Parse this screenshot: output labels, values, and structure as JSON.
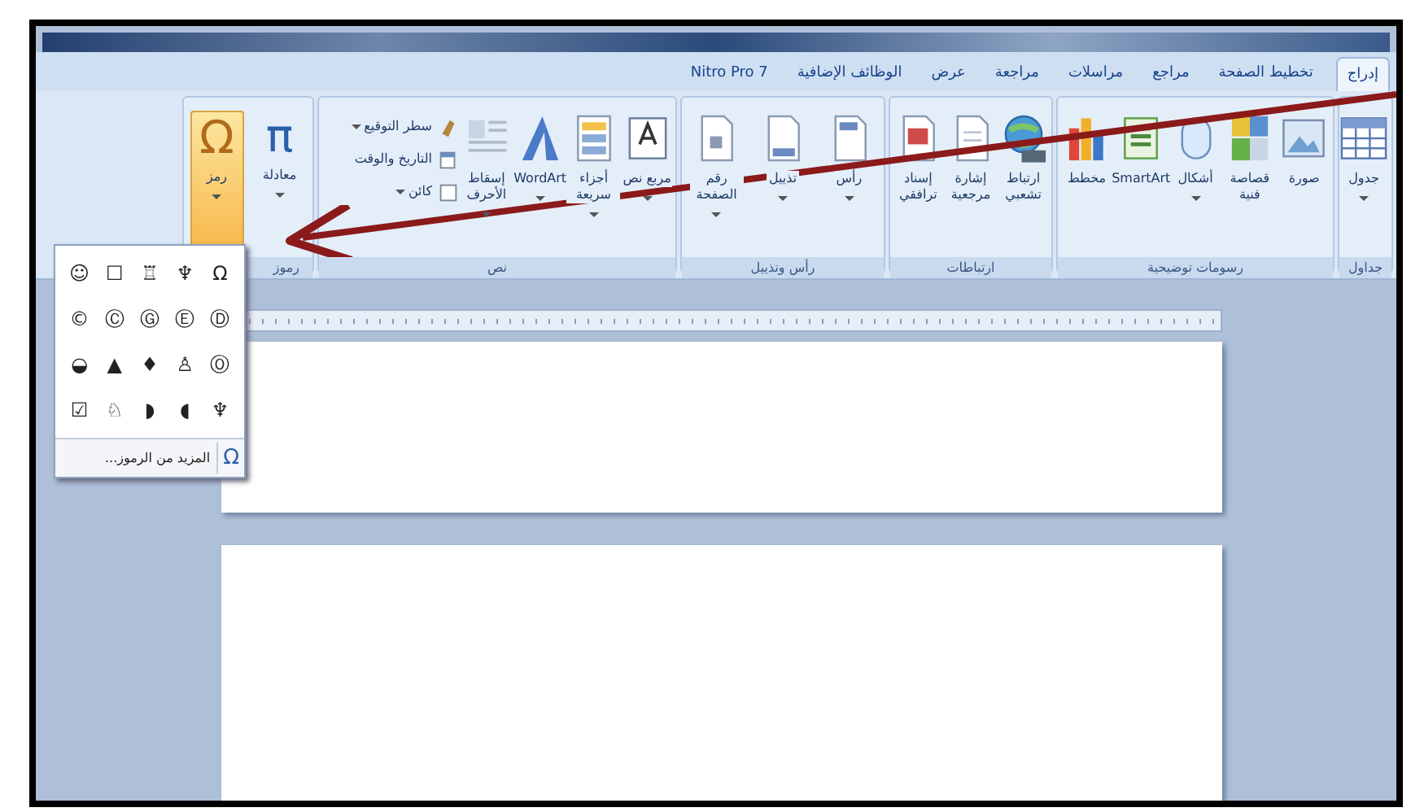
{
  "tabs": [
    {
      "label": "إدراج",
      "selected": true
    },
    {
      "label": "تخطيط الصفحة",
      "selected": false
    },
    {
      "label": "مراجع",
      "selected": false
    },
    {
      "label": "مراسلات",
      "selected": false
    },
    {
      "label": "مراجعة",
      "selected": false
    },
    {
      "label": "عرض",
      "selected": false
    },
    {
      "label": "الوظائف الإضافية",
      "selected": false
    },
    {
      "label": "Nitro Pro 7",
      "selected": false
    }
  ],
  "ribbon": {
    "groups": [
      {
        "label": "جداول",
        "items": [
          {
            "kind": "large",
            "label": "جدول",
            "dropdown": true,
            "pressed": false
          }
        ]
      },
      {
        "label": "رسومات توضيحية",
        "items": [
          {
            "kind": "large",
            "label": "صورة",
            "dropdown": false,
            "pressed": false
          },
          {
            "kind": "large",
            "label": "قصاصة فنية",
            "dropdown": false,
            "pressed": false
          },
          {
            "kind": "large",
            "label": "أشكال",
            "dropdown": true,
            "pressed": false
          },
          {
            "kind": "large",
            "label": "SmartArt",
            "dropdown": false,
            "pressed": false
          },
          {
            "kind": "large",
            "label": "مخطط",
            "dropdown": false,
            "pressed": false
          }
        ]
      },
      {
        "label": "ارتباطات",
        "items": [
          {
            "kind": "large",
            "label": "ارتباط تشعبي",
            "dropdown": false,
            "pressed": false
          },
          {
            "kind": "large",
            "label": "إشارة مرجعية",
            "dropdown": false,
            "pressed": false
          },
          {
            "kind": "large",
            "label": "إسناد ترافقي",
            "dropdown": false,
            "pressed": false
          }
        ]
      },
      {
        "label": "رأس وتذييل",
        "items": [
          {
            "kind": "large",
            "label": "رأس",
            "dropdown": true,
            "pressed": false
          },
          {
            "kind": "large",
            "label": "تذييل",
            "dropdown": true,
            "pressed": false
          },
          {
            "kind": "large",
            "label": "رقم الصفحة",
            "dropdown": true,
            "pressed": false
          }
        ]
      },
      {
        "label": "نص",
        "items": [
          {
            "kind": "large",
            "label": "مربع نص",
            "dropdown": true,
            "pressed": false
          },
          {
            "kind": "large",
            "label": "أجزاء سريعة",
            "dropdown": true,
            "pressed": false
          },
          {
            "kind": "large",
            "label": "WordArt",
            "dropdown": true,
            "pressed": false
          },
          {
            "kind": "large",
            "label": "إسقاط الأحرف",
            "dropdown": true,
            "pressed": false
          },
          {
            "kind": "small",
            "label": "سطر التوقيع",
            "dropdown": true,
            "pressed": false
          },
          {
            "kind": "small",
            "label": "التاريخ والوقت",
            "dropdown": false,
            "pressed": false
          },
          {
            "kind": "small",
            "label": "كائن",
            "dropdown": true,
            "pressed": false
          }
        ]
      },
      {
        "label": "رموز",
        "items": [
          {
            "kind": "large",
            "label": "معادلة",
            "glyph": "π",
            "dropdown": true,
            "pressed": false
          },
          {
            "kind": "large",
            "label": "رمز",
            "glyph": "Ω",
            "dropdown": true,
            "pressed": true
          }
        ]
      }
    ]
  },
  "symbol_menu": {
    "symbols": [
      [
        "Ω",
        "♆",
        "♖",
        "☐",
        "☺"
      ],
      [
        "Ⓓ",
        "Ⓔ",
        "Ⓖ",
        "Ⓒ",
        "©"
      ],
      [
        "Ⓞ",
        "♙",
        "♦",
        "▲",
        "◒"
      ],
      [
        "♆",
        "◖",
        "◗",
        "♘",
        "☑"
      ]
    ],
    "more": {
      "glyph": "Ω",
      "label": "المزيد من الرموز..."
    }
  }
}
